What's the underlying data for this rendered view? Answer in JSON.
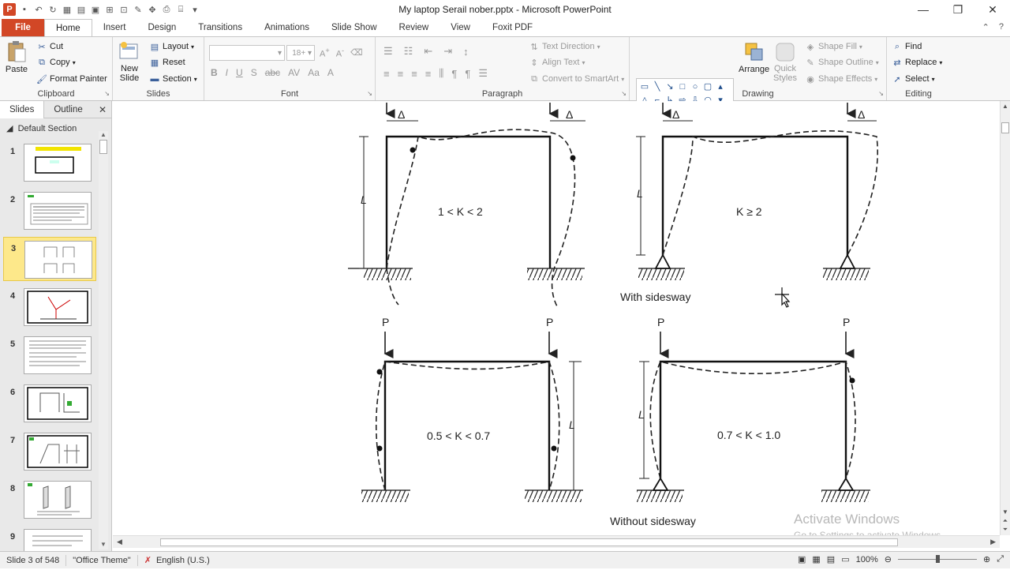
{
  "window": {
    "title": "My laptop Serail nober.pptx  -  Microsoft PowerPoint"
  },
  "tabs": [
    {
      "label": "File"
    },
    {
      "label": "Home"
    },
    {
      "label": "Insert"
    },
    {
      "label": "Design"
    },
    {
      "label": "Transitions"
    },
    {
      "label": "Animations"
    },
    {
      "label": "Slide Show"
    },
    {
      "label": "Review"
    },
    {
      "label": "View"
    },
    {
      "label": "Foxit PDF"
    }
  ],
  "ribbon": {
    "clipboard": {
      "label": "Clipboard",
      "paste": "Paste",
      "cut": "Cut",
      "copy": "Copy",
      "format_painter": "Format Painter"
    },
    "slides": {
      "label": "Slides",
      "new_slide_1": "New",
      "new_slide_2": "Slide",
      "layout": "Layout",
      "reset": "Reset",
      "section": "Section"
    },
    "font": {
      "label": "Font",
      "font_size": "18+"
    },
    "paragraph": {
      "label": "Paragraph",
      "text_direction": "Text Direction",
      "align_text": "Align Text",
      "convert_smartart": "Convert to SmartArt"
    },
    "drawing": {
      "label": "Drawing",
      "arrange": "Arrange",
      "quick_styles_1": "Quick",
      "quick_styles_2": "Styles",
      "shape_fill": "Shape Fill",
      "shape_outline": "Shape Outline",
      "shape_effects": "Shape Effects"
    },
    "editing": {
      "label": "Editing",
      "find": "Find",
      "replace": "Replace",
      "select": "Select"
    }
  },
  "left_pane": {
    "tabs": [
      "Slides",
      "Outline"
    ],
    "section": "Default Section",
    "slide_numbers": [
      "1",
      "2",
      "3",
      "4",
      "5",
      "6",
      "7",
      "8",
      "9"
    ],
    "selected_slide": 3
  },
  "slide_content": {
    "panels": [
      {
        "label": "1 < K < 2"
      },
      {
        "label": "K ≥ 2"
      },
      {
        "label": "0.5 < K < 0.7"
      },
      {
        "label": "0.7 < K < 1.0"
      }
    ],
    "with_sidesway": "With sidesway",
    "without_sidesway": "Without sidesway",
    "delta": "Δ",
    "length_label": "L",
    "load_label": "P"
  },
  "status": {
    "slide_info": "Slide 3 of 548",
    "theme": "\"Office Theme\"",
    "language": "English (U.S.)",
    "zoom": "100%"
  },
  "watermark": {
    "line1": "Activate Windows",
    "line2": "Go to Settings to activate Windows."
  }
}
